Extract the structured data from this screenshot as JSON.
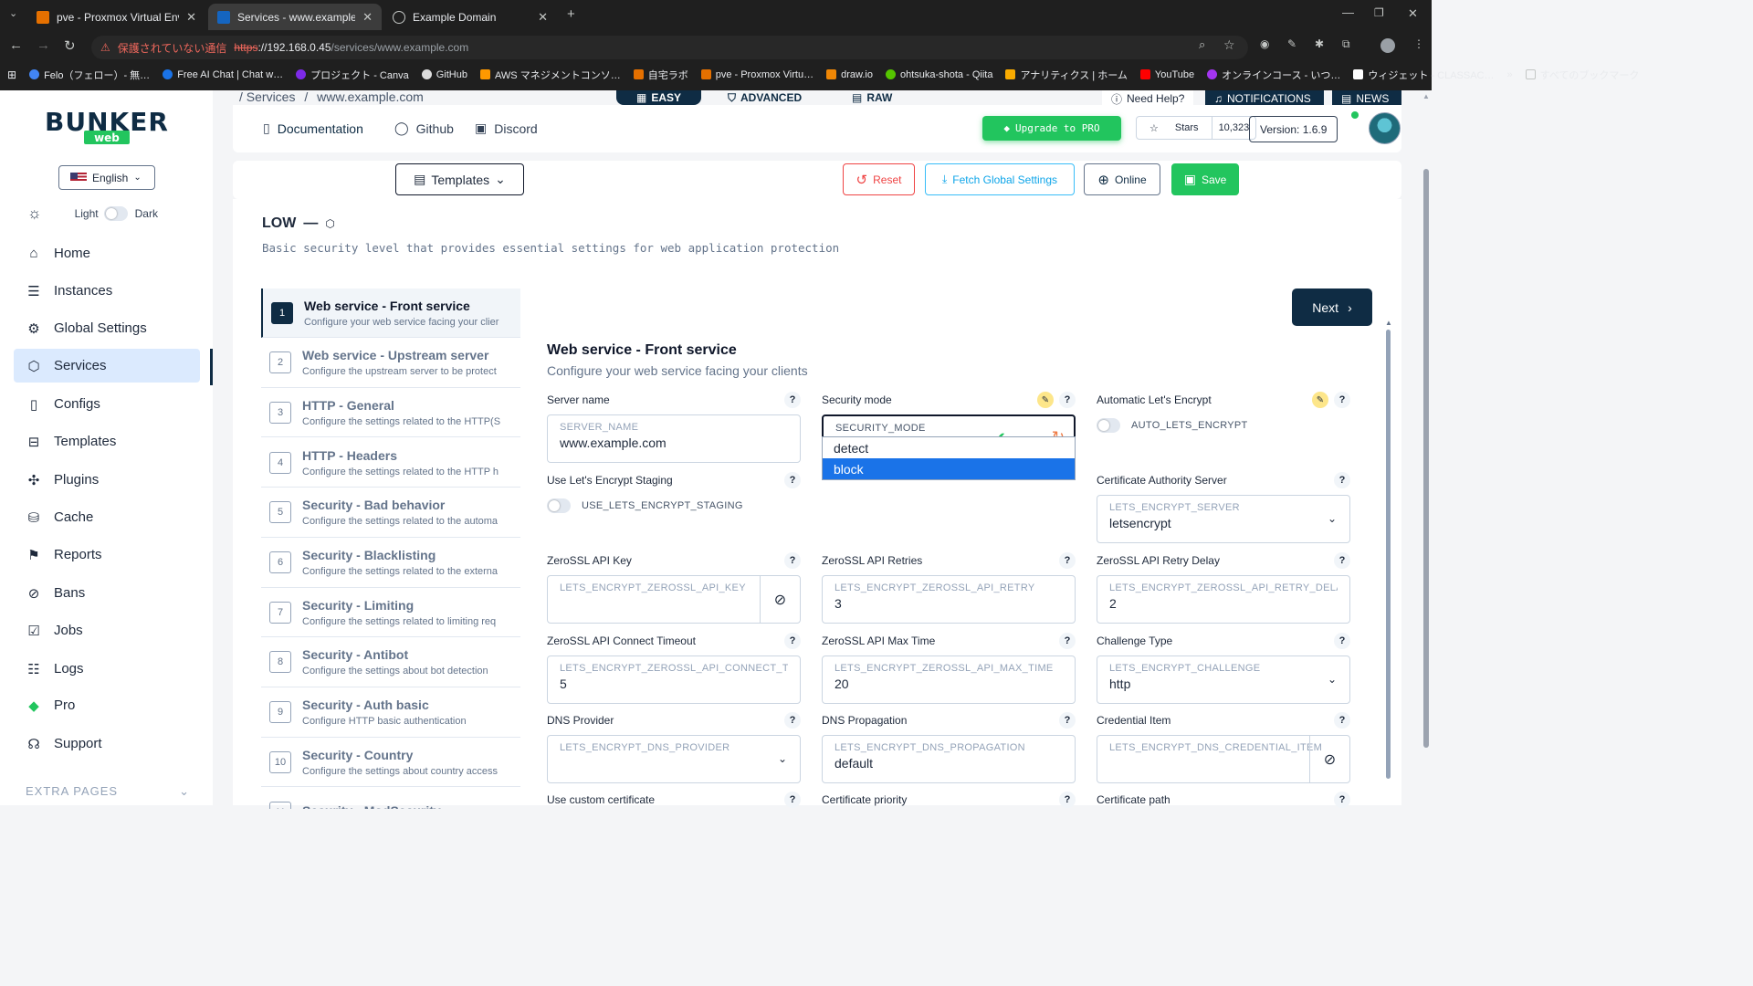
{
  "browser": {
    "tabs": [
      {
        "title": "pve - Proxmox Virtual Environm",
        "active": false
      },
      {
        "title": "Services - www.example.com - I",
        "active": true
      },
      {
        "title": "Example Domain",
        "active": false
      }
    ],
    "security_label": "保護されていない通信",
    "url_scheme": "https",
    "url_host": "://192.168.0.45",
    "url_path": "/services/www.example.com",
    "bookmarks": [
      "Felo（フェロー）- 無…",
      "Free AI Chat | Chat w…",
      "プロジェクト - Canva",
      "GitHub",
      "AWS マネジメントコンソ…",
      "自宅ラボ",
      "pve - Proxmox Virtu…",
      "draw.io",
      "ohtsuka-shota - Qiita",
      "アナリティクス | ホーム",
      "YouTube",
      "オンラインコース - いつ…",
      "ウィジェット - CLASSAC…"
    ],
    "all_bookmarks": "すべてのブックマーク"
  },
  "sidebar": {
    "language": "English",
    "theme_light": "Light",
    "theme_dark": "Dark",
    "items": [
      {
        "label": "Home",
        "icon": "home-icon"
      },
      {
        "label": "Instances",
        "icon": "server-icon"
      },
      {
        "label": "Global Settings",
        "icon": "gear-icon"
      },
      {
        "label": "Services",
        "icon": "cube-icon",
        "active": true
      },
      {
        "label": "Configs",
        "icon": "file-icon"
      },
      {
        "label": "Templates",
        "icon": "layout-icon"
      },
      {
        "label": "Plugins",
        "icon": "puzzle-icon"
      },
      {
        "label": "Cache",
        "icon": "database-icon"
      },
      {
        "label": "Reports",
        "icon": "flag-icon"
      },
      {
        "label": "Bans",
        "icon": "ban-icon"
      },
      {
        "label": "Jobs",
        "icon": "clipboard-check-icon"
      },
      {
        "label": "Logs",
        "icon": "list-icon"
      },
      {
        "label": "Pro",
        "icon": "diamond-icon"
      },
      {
        "label": "Support",
        "icon": "headset-icon"
      }
    ],
    "extra_pages": "EXTRA PAGES"
  },
  "header": {
    "breadcrumb_root": "/ Services",
    "breadcrumb_sep": "/",
    "breadcrumb_current": "www.example.com",
    "modes": [
      "EASY",
      "ADVANCED",
      "RAW"
    ],
    "need_help": "Need Help?",
    "notifications": "NOTIFICATIONS",
    "news": "NEWS",
    "links": [
      "Documentation",
      "Github",
      "Discord"
    ],
    "upgrade": "Upgrade to PRO",
    "stars_label": "Stars",
    "stars_count": "10,323",
    "version": "Version: 1.6.9"
  },
  "toolbar": {
    "templates": "Templates",
    "reset": "Reset",
    "fetch": "Fetch Global Settings",
    "online": "Online",
    "save": "Save"
  },
  "level": {
    "title": "LOW",
    "dash": "—",
    "description": "Basic security level that provides essential settings for web application protection"
  },
  "steps": [
    {
      "num": "1",
      "title": "Web service - Front service",
      "desc": "Configure your web service facing your clier",
      "active": true
    },
    {
      "num": "2",
      "title": "Web service - Upstream server",
      "desc": "Configure the upstream server to be protect"
    },
    {
      "num": "3",
      "title": "HTTP - General",
      "desc": "Configure the settings related to the HTTP(S"
    },
    {
      "num": "4",
      "title": "HTTP - Headers",
      "desc": "Configure the settings related to the HTTP h"
    },
    {
      "num": "5",
      "title": "Security - Bad behavior",
      "desc": "Configure the settings related to the automa"
    },
    {
      "num": "6",
      "title": "Security - Blacklisting",
      "desc": "Configure the settings related to the externa"
    },
    {
      "num": "7",
      "title": "Security - Limiting",
      "desc": "Configure the settings related to limiting req"
    },
    {
      "num": "8",
      "title": "Security - Antibot",
      "desc": "Configure the settings about bot detection"
    },
    {
      "num": "9",
      "title": "Security - Auth basic",
      "desc": "Configure HTTP basic authentication"
    },
    {
      "num": "10",
      "title": "Security - Country",
      "desc": "Configure the settings about country access"
    },
    {
      "num": "11",
      "title": "Security - ModSecurity",
      "desc": ""
    }
  ],
  "next": "Next",
  "form": {
    "title": "Web service - Front service",
    "description": "Configure your web service facing your clients",
    "server_name": {
      "label": "Server name",
      "setting": "SERVER_NAME",
      "value": "www.example.com"
    },
    "security_mode": {
      "label": "Security mode",
      "setting": "SECURITY_MODE",
      "value": "block",
      "options": [
        "detect",
        "block"
      ]
    },
    "auto_le": {
      "label": "Automatic Let's Encrypt",
      "setting": "AUTO_LETS_ENCRYPT"
    },
    "le_staging": {
      "label": "Use Let's Encrypt Staging",
      "setting": "USE_LETS_ENCRYPT_STAGING"
    },
    "ca_server": {
      "label": "Certificate Authority Server",
      "setting": "LETS_ENCRYPT_SERVER",
      "value": "letsencrypt"
    },
    "zerossl_key": {
      "label": "ZeroSSL API Key",
      "setting": "LETS_ENCRYPT_ZEROSSL_API_KEY"
    },
    "zerossl_retries": {
      "label": "ZeroSSL API Retries",
      "setting": "LETS_ENCRYPT_ZEROSSL_API_RETRY",
      "value": "3"
    },
    "zerossl_delay": {
      "label": "ZeroSSL API Retry Delay",
      "setting": "LETS_ENCRYPT_ZEROSSL_API_RETRY_DELAY",
      "value": "2"
    },
    "zerossl_connect": {
      "label": "ZeroSSL API Connect Timeout",
      "setting": "LETS_ENCRYPT_ZEROSSL_API_CONNECT_TIM",
      "value": "5"
    },
    "zerossl_max": {
      "label": "ZeroSSL API Max Time",
      "setting": "LETS_ENCRYPT_ZEROSSL_API_MAX_TIME",
      "value": "20"
    },
    "challenge": {
      "label": "Challenge Type",
      "setting": "LETS_ENCRYPT_CHALLENGE",
      "value": "http"
    },
    "dns_provider": {
      "label": "DNS Provider",
      "setting": "LETS_ENCRYPT_DNS_PROVIDER"
    },
    "dns_prop": {
      "label": "DNS Propagation",
      "setting": "LETS_ENCRYPT_DNS_PROPAGATION",
      "value": "default"
    },
    "cred_item": {
      "label": "Credential Item",
      "setting": "LETS_ENCRYPT_DNS_CREDENTIAL_ITEM"
    },
    "custom_cert": {
      "label": "Use custom certificate"
    },
    "cert_priority": {
      "label": "Certificate priority"
    },
    "cert_path": {
      "label": "Certificate path"
    }
  },
  "colors": {
    "primary": "#0f2c44",
    "success": "#22c55e",
    "danger": "#ef4444",
    "info": "#38bdf8",
    "select": "#1a73e8"
  }
}
